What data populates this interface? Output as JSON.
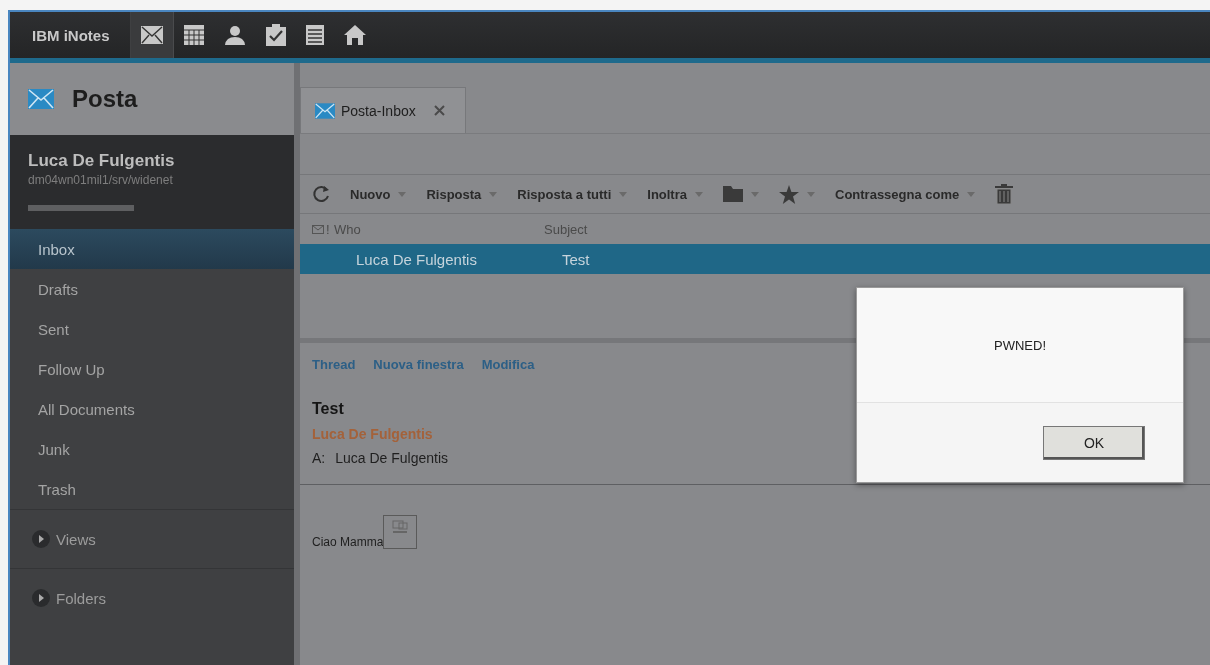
{
  "app": {
    "brand": "IBM iNotes",
    "nav_icons": [
      {
        "kind": "mail",
        "selected": true
      },
      {
        "kind": "calendar",
        "selected": false
      },
      {
        "kind": "contacts",
        "selected": false
      },
      {
        "kind": "todo",
        "selected": false
      },
      {
        "kind": "notebook",
        "selected": false
      },
      {
        "kind": "home",
        "selected": false
      }
    ]
  },
  "sidebar": {
    "title": "Posta",
    "user": "Luca De Fulgentis",
    "server": "dm04wn01mil1/srv/widenet",
    "items": [
      {
        "label": "Inbox",
        "selected": true
      },
      {
        "label": "Drafts",
        "selected": false
      },
      {
        "label": "Sent",
        "selected": false
      },
      {
        "label": "Follow Up",
        "selected": false
      },
      {
        "label": "All Documents",
        "selected": false
      },
      {
        "label": "Junk",
        "selected": false
      },
      {
        "label": "Trash",
        "selected": false
      }
    ],
    "sections": [
      {
        "label": "Views",
        "expanded": false
      },
      {
        "label": "Folders",
        "expanded": false
      }
    ]
  },
  "tabs": [
    {
      "label": "Posta-Inbox",
      "selected": true
    }
  ],
  "toolbar": [
    {
      "kind": "refresh"
    },
    {
      "kind": "menu",
      "label": "Nuovo"
    },
    {
      "kind": "menu",
      "label": "Risposta"
    },
    {
      "kind": "menu",
      "label": "Risposta a tutti"
    },
    {
      "kind": "menu",
      "label": "Inoltra"
    },
    {
      "kind": "folder"
    },
    {
      "kind": "star"
    },
    {
      "kind": "menu",
      "label": "Contrassegna come"
    },
    {
      "kind": "trash"
    }
  ],
  "table": {
    "columns": [
      "!",
      "Who",
      "Subject"
    ],
    "rows": [
      {
        "who": "Luca De Fulgentis",
        "subject": "Test",
        "selected": true
      }
    ]
  },
  "preview": {
    "actions": [
      "Thread",
      "Nuova finestra",
      "Modifica"
    ],
    "subject": "Test",
    "from": "Luca De Fulgentis",
    "to_label": "A:",
    "to": "Luca De Fulgentis",
    "body": "Ciao Mamma"
  },
  "dialog": {
    "message": "PWNED!",
    "button": "OK"
  }
}
